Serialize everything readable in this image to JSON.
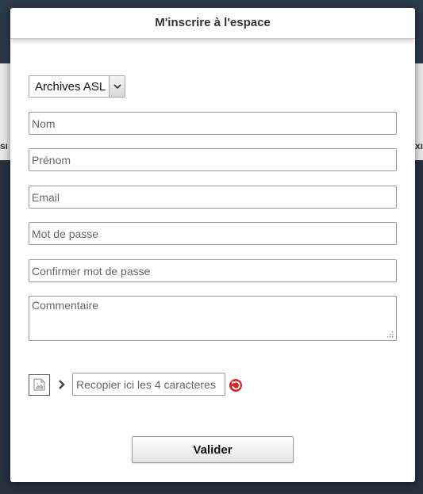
{
  "background": {
    "left_fragment": "sı",
    "right_fragment": "xı"
  },
  "modal": {
    "title": "M'inscrire à l'espace"
  },
  "form": {
    "space_select": {
      "value": "Archives ASL",
      "icon": "chevron-down-icon"
    },
    "nom": {
      "placeholder": "Nom"
    },
    "prenom": {
      "placeholder": "Prénom"
    },
    "email": {
      "placeholder": "Email"
    },
    "password": {
      "placeholder": "Mot de passe"
    },
    "password_confirm": {
      "placeholder": "Confirmer mot de passe"
    },
    "comment": {
      "placeholder": "Commentaire"
    },
    "captcha": {
      "image_icon": "broken-image-icon",
      "arrow_icon": "chevron-right-icon",
      "placeholder": "Recopier ici les 4 caracteres",
      "refresh_icon": "refresh-icon"
    },
    "submit_label": "Valider"
  },
  "colors": {
    "refresh": "#d6262b",
    "page_background": "#2b3a48"
  }
}
